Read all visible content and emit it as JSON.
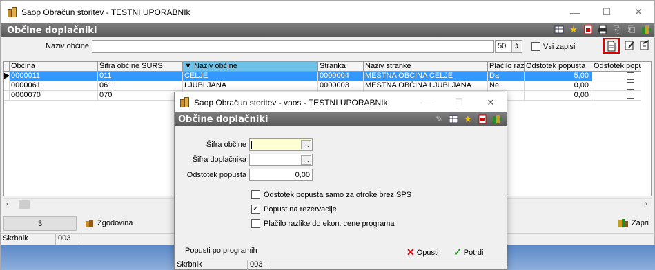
{
  "main_window": {
    "title": "Saop Obračun storitev - TESTNI UPORABNIk",
    "controls": {
      "minimize": "—",
      "maximize": "☐",
      "close": "✕"
    },
    "header_title": "Občine doplačniki",
    "filter": {
      "label": "Naziv občine",
      "value": "",
      "count": "50",
      "all_records_label": "Vsi zapisi"
    }
  },
  "grid": {
    "columns": [
      "Občina",
      "Šifra občine SURS",
      "▼ Naziv občine",
      "Stranka",
      "Naziv stranke",
      "Plačilo razlike",
      "Odstotek popusta",
      "Odstotek popu"
    ],
    "rows": [
      {
        "obcina": "0000011",
        "sifra": "011",
        "naziv": "CELJE",
        "stranka": "0000004",
        "naziv_stranke": "MESTNA OBČINA CELJE",
        "placilo": "Da",
        "odstotek": "5,00"
      },
      {
        "obcina": "0000061",
        "sifra": "061",
        "naziv": "LJUBLJANA",
        "stranka": "0000003",
        "naziv_stranke": "MESTNA OBČINA LJUBLJANA",
        "placilo": "Ne",
        "odstotek": "0,00"
      },
      {
        "obcina": "0000070",
        "sifra": "070",
        "naziv": "",
        "stranka": "",
        "naziv_stranke": "",
        "placilo": "",
        "odstotek": "0,00"
      }
    ]
  },
  "nav": {
    "count": "3",
    "history_label": "Zgodovina",
    "close_label": "Zapri"
  },
  "status": {
    "label": "Skrbnik",
    "value": "003"
  },
  "dialog": {
    "title": "Saop Obračun storitev - vnos - TESTNI UPORABNIk",
    "header_title": "Občine doplačniki",
    "fields": {
      "sifra_obcine_label": "Šifra občine",
      "sifra_obcine_value": "",
      "sifra_doplacnika_label": "Šifra doplačnika",
      "sifra_doplacnika_value": "",
      "odstotek_label": "Odstotek popusta",
      "odstotek_value": "0,00"
    },
    "checkboxes": [
      {
        "label": "Odstotek popusta samo za otroke brez SPS",
        "checked": false
      },
      {
        "label": "Popust na rezervacije",
        "checked": true
      },
      {
        "label": "Plačilo razlike do ekon. cene programa",
        "checked": false
      }
    ],
    "popusti_label": "Popusti po programih",
    "cancel_label": "Opusti",
    "confirm_label": "Potrdi",
    "status": {
      "label": "Skrbnik",
      "value": "003"
    }
  }
}
